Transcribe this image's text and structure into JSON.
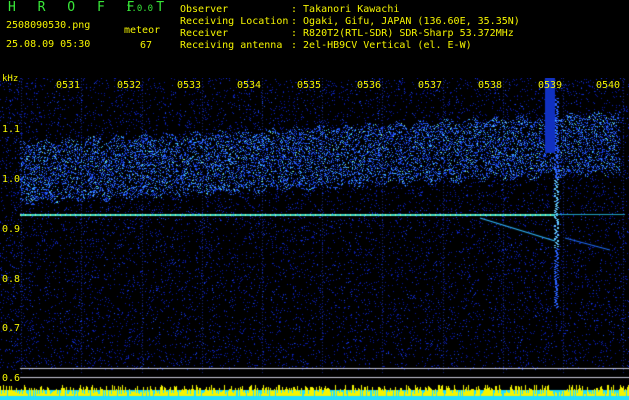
{
  "header": {
    "app_name": "H R O F F T",
    "version": "1.0.0",
    "filename": "2508090530.png",
    "meteor_label": "meteor",
    "meteor_count": "67",
    "datetime": "25.08.09 05:30"
  },
  "metadata": [
    {
      "key": "Observer",
      "value": ": Takanori Kawachi"
    },
    {
      "key": "Receiving Location",
      "value": ": Ogaki, Gifu, JAPAN (136.60E, 35.35N)"
    },
    {
      "key": "Receiver",
      "value": ": R820T2(RTL-SDR) SDR-Sharp 53.372MHz"
    },
    {
      "key": "Receiving antenna",
      "value": ": 2el-HB9CV Vertical (el. E-W)"
    }
  ],
  "axis": {
    "y_unit": "kHz",
    "x_ticks": [
      "0531",
      "0532",
      "0533",
      "0534",
      "0535",
      "0536",
      "0537",
      "0538",
      "0539",
      "0540"
    ],
    "y_ticks": [
      "1.1",
      "1.0",
      "0.9",
      "0.8",
      "0.7",
      "0.6"
    ]
  },
  "colors": {
    "background": "#000000",
    "noise": "#0a1aa8",
    "signal": "#00c8ff",
    "carrier": "#7fffb0",
    "header_green": "#38e838",
    "header_yellow": "#f5f500",
    "activity_yellow": "#f5f500",
    "activity_cyan": "#20e0ff"
  }
}
